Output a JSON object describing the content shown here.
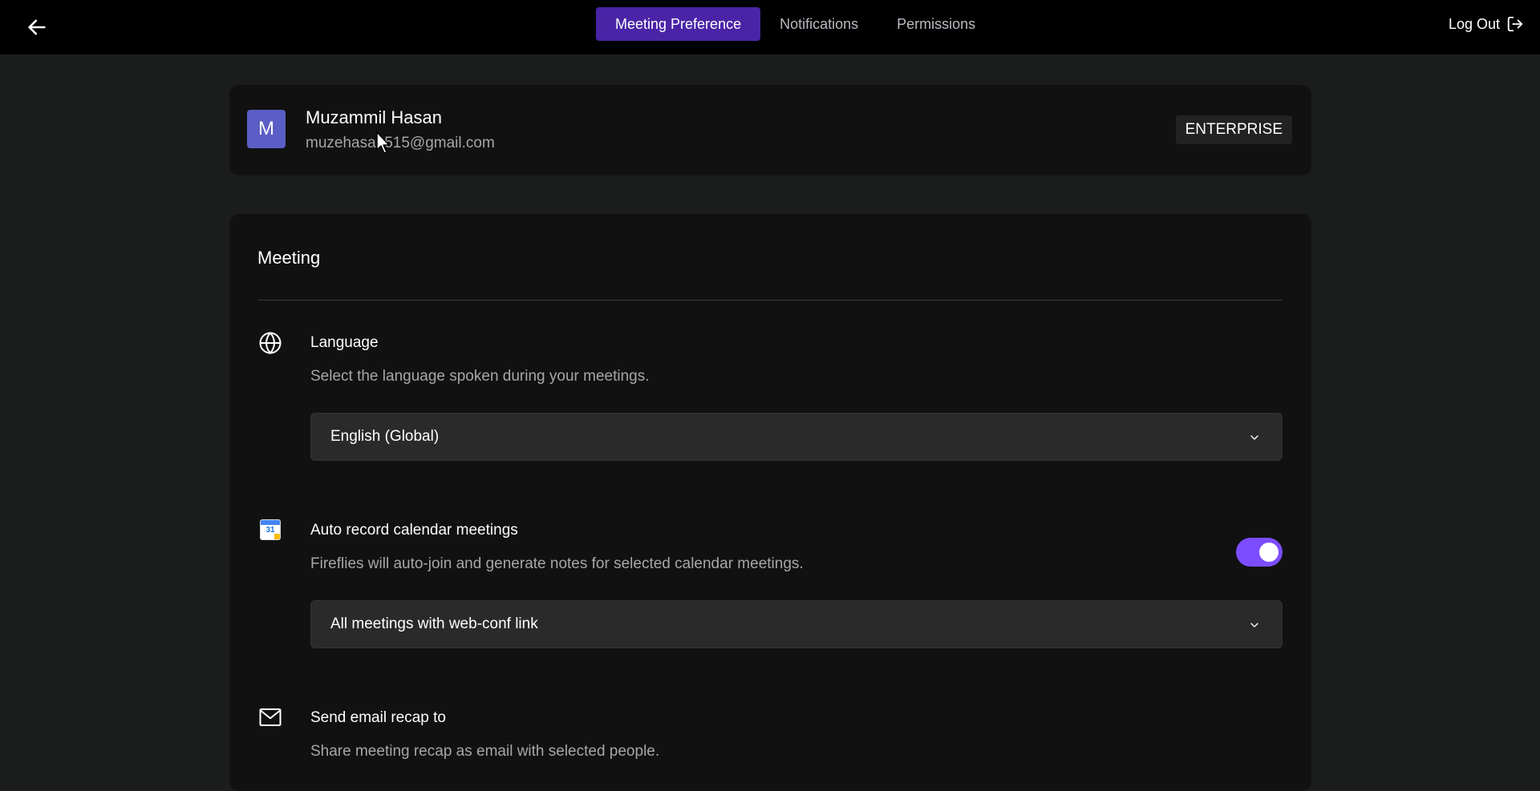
{
  "nav": {
    "tabs": [
      {
        "label": "Meeting Preference",
        "active": true
      },
      {
        "label": "Notifications",
        "active": false
      },
      {
        "label": "Permissions",
        "active": false
      }
    ],
    "logout_label": "Log Out"
  },
  "profile": {
    "avatar_initial": "M",
    "name": "Muzammil Hasan",
    "email": "muzehasan515@gmail.com",
    "plan": "ENTERPRISE"
  },
  "meeting": {
    "title": "Meeting",
    "language": {
      "label": "Language",
      "description": "Select the language spoken during your meetings.",
      "selected": "English (Global)"
    },
    "auto_record": {
      "label": "Auto record calendar meetings",
      "description": "Fireflies will auto-join and generate notes for selected calendar meetings.",
      "enabled": true,
      "selected": "All meetings with web-conf link",
      "calendar_day": "31"
    },
    "email_recap": {
      "label": "Send email recap to",
      "description": "Share meeting recap as email with selected people."
    }
  },
  "colors": {
    "accent": "#4a24a6",
    "toggle_on": "#7c4dff",
    "avatar_bg": "#5b5ec4",
    "background": "#1b1d1c",
    "card": "#111111"
  },
  "icons": {
    "back": "arrow-left-icon",
    "logout": "logout-icon",
    "language": "globe-icon",
    "auto_record": "google-calendar-icon",
    "email_recap": "mail-icon",
    "select": "chevron-down-icon"
  }
}
